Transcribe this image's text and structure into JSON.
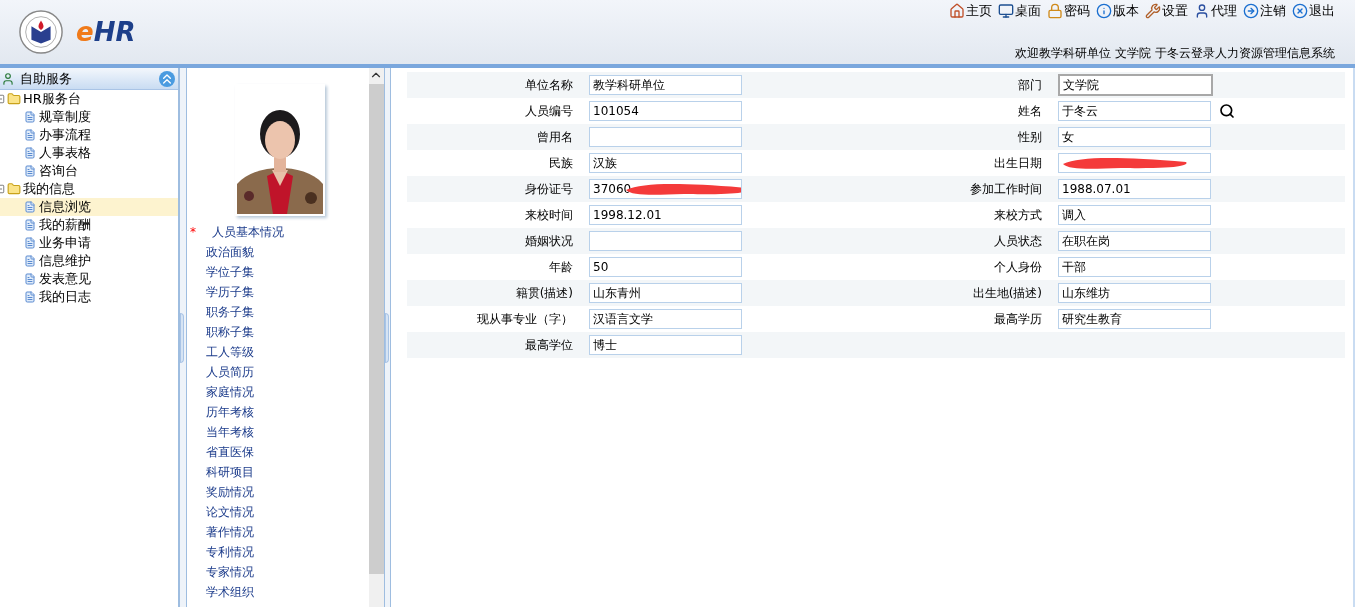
{
  "header": {
    "logo_text": [
      "e",
      "HR"
    ],
    "toolbar": [
      {
        "label": "主页",
        "kind": "home"
      },
      {
        "label": "桌面",
        "kind": "monitor"
      },
      {
        "label": "密码",
        "kind": "lock"
      },
      {
        "label": "版本",
        "kind": "info"
      },
      {
        "label": "设置",
        "kind": "wrench"
      },
      {
        "label": "代理",
        "kind": "user"
      },
      {
        "label": "注销",
        "kind": "logout"
      },
      {
        "label": "退出",
        "kind": "exit"
      }
    ],
    "welcome": "欢迎教学科研单位 文学院 于冬云登录人力资源管理信息系统"
  },
  "sidebar": {
    "title": "自助服务",
    "tree": [
      {
        "label": "HR服务台",
        "expanded": true,
        "children": [
          {
            "label": "规章制度",
            "selected": false
          },
          {
            "label": "办事流程",
            "selected": false
          },
          {
            "label": "人事表格",
            "selected": false
          },
          {
            "label": "咨询台",
            "selected": false
          }
        ]
      },
      {
        "label": "我的信息",
        "expanded": true,
        "children": [
          {
            "label": "信息浏览",
            "selected": true
          },
          {
            "label": "我的薪酬",
            "selected": false
          },
          {
            "label": "业务申请",
            "selected": false
          },
          {
            "label": "信息维护",
            "selected": false
          },
          {
            "label": "发表意见",
            "selected": false
          },
          {
            "label": "我的日志",
            "selected": false
          }
        ]
      }
    ]
  },
  "subsets": {
    "marker": "*",
    "items": [
      {
        "label": "人员基本情况",
        "selected": true
      },
      {
        "label": "政治面貌",
        "selected": false
      },
      {
        "label": "学位子集",
        "selected": false
      },
      {
        "label": "学历子集",
        "selected": false
      },
      {
        "label": "职务子集",
        "selected": false
      },
      {
        "label": "职称子集",
        "selected": false
      },
      {
        "label": "工人等级",
        "selected": false
      },
      {
        "label": "人员简历",
        "selected": false
      },
      {
        "label": "家庭情况",
        "selected": false
      },
      {
        "label": "历年考核",
        "selected": false
      },
      {
        "label": "当年考核",
        "selected": false
      },
      {
        "label": "省直医保",
        "selected": false
      },
      {
        "label": "科研项目",
        "selected": false
      },
      {
        "label": "奖励情况",
        "selected": false
      },
      {
        "label": "论文情况",
        "selected": false
      },
      {
        "label": "著作情况",
        "selected": false
      },
      {
        "label": "专利情况",
        "selected": false
      },
      {
        "label": "专家情况",
        "selected": false
      },
      {
        "label": "学术组织",
        "selected": false
      }
    ]
  },
  "form": {
    "rows": [
      {
        "left": {
          "label": "单位名称",
          "value": "教学科研单位"
        },
        "right": {
          "label": "部门",
          "value": "文学院",
          "focused": true
        }
      },
      {
        "left": {
          "label": "人员编号",
          "value": "101054"
        },
        "right": {
          "label": "姓名",
          "value": "于冬云",
          "lookup": true
        }
      },
      {
        "left": {
          "label": "曾用名"
        },
        "right": {
          "label": "性别",
          "value": "女"
        }
      },
      {
        "left": {
          "label": "民族",
          "value": "汉族"
        },
        "right": {
          "label": "出生日期",
          "redacted": true
        }
      },
      {
        "left": {
          "label": "身份证号",
          "value": "37060",
          "redacted": true
        },
        "right": {
          "label": "参加工作时间",
          "value": "1988.07.01"
        }
      },
      {
        "left": {
          "label": "来校时间",
          "value": "1998.12.01"
        },
        "right": {
          "label": "来校方式",
          "value": "调入"
        }
      },
      {
        "left": {
          "label": "婚姻状况"
        },
        "right": {
          "label": "人员状态",
          "value": "在职在岗"
        }
      },
      {
        "left": {
          "label": "年龄",
          "value": "50"
        },
        "right": {
          "label": "个人身份",
          "value": "干部"
        }
      },
      {
        "left": {
          "label": "籍贯(描述)",
          "value": "山东青州"
        },
        "right": {
          "label": "出生地(描述)",
          "value": "山东维坊"
        }
      },
      {
        "left": {
          "label": "现从事专业（字）",
          "value": "汉语言文学"
        },
        "right": {
          "label": "最高学历",
          "value": "研究生教育"
        }
      },
      {
        "left": {
          "label": "最高学位",
          "value": "博士"
        }
      }
    ]
  }
}
